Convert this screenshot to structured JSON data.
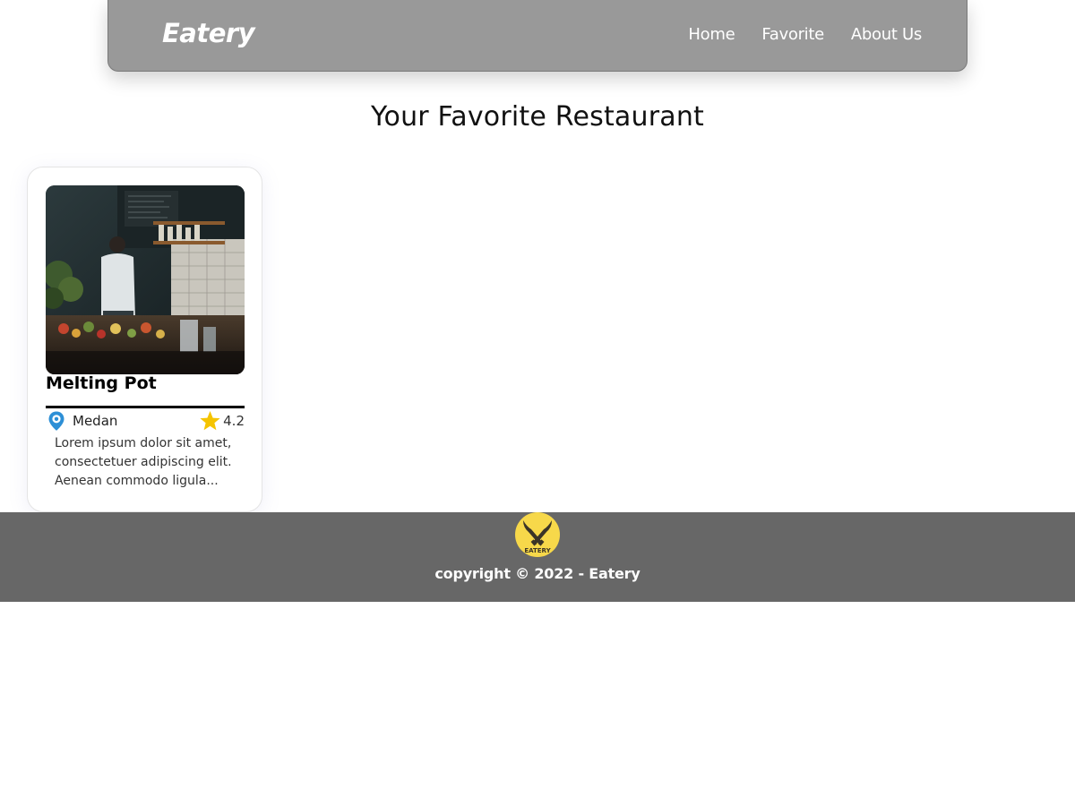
{
  "navbar": {
    "brand": "Eatery",
    "links": [
      "Home",
      "Favorite",
      "About Us"
    ]
  },
  "page": {
    "title": "Your Favorite Restaurant"
  },
  "restaurants": [
    {
      "name": "Melting Pot",
      "city": "Medan",
      "rating": "4.2",
      "description": "Lorem ipsum dolor sit amet, consectetuer adipiscing elit. Aenean commodo ligula...",
      "icons": {
        "location": "map-pin-icon",
        "rating": "star-icon"
      }
    }
  ],
  "footer": {
    "logo_text": "EATERY",
    "copyright": "copyright © 2022 - Eatery"
  },
  "colors": {
    "navbar_bg": "#999999",
    "footer_bg": "#676767",
    "logo_yellow": "#f7d84a",
    "pin_blue": "#2d8fd6",
    "star_yellow": "#f5c400"
  }
}
